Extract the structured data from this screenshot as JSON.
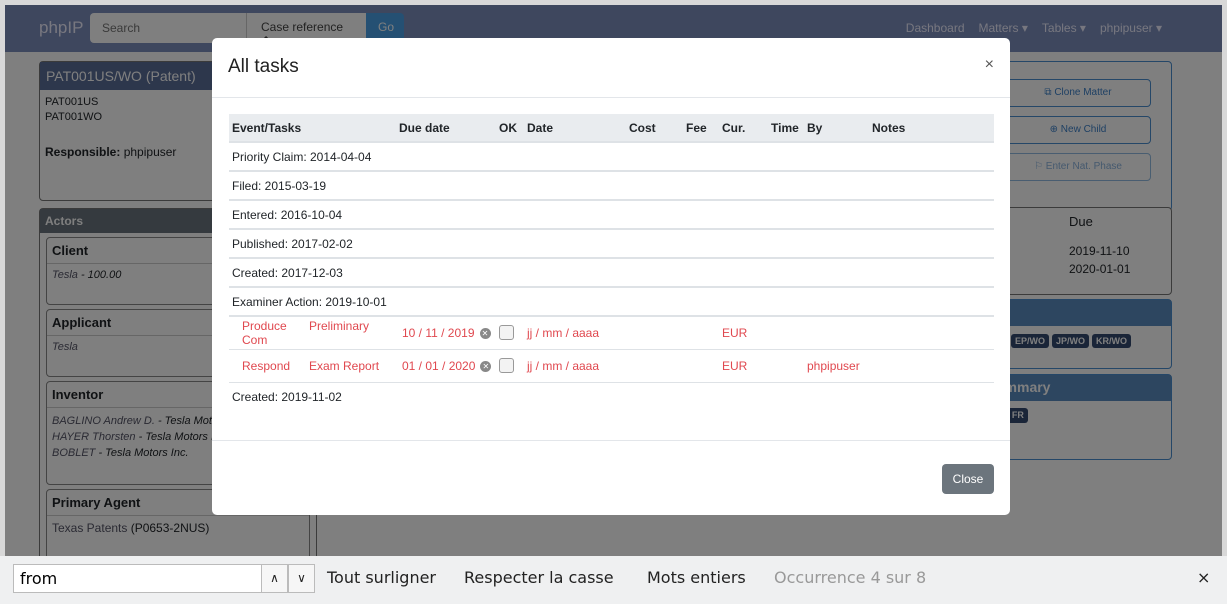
{
  "navbar": {
    "brand": "phpIP",
    "search_placeholder": "Search",
    "search_select": "Case reference",
    "go": "Go",
    "items": [
      "Dashboard",
      "Matters ▾",
      "Tables ▾",
      "phpipuser ▾"
    ]
  },
  "matter": {
    "title": "PAT001US/WO (Patent)",
    "refs": [
      "PAT001US",
      "PAT001WO"
    ],
    "responsible_label": "Responsible:",
    "responsible": "phpipuser"
  },
  "actions": [
    "⧉ Clone Matter",
    "⊕ New Child",
    "⚐ Enter Nat. Phase"
  ],
  "actors": {
    "title": "Actors",
    "groups": [
      {
        "role": "Client",
        "lines": [
          {
            "name": "Tesla",
            "extra": " - 100.00"
          }
        ]
      },
      {
        "role": "Applicant",
        "lines": [
          {
            "name": "Tesla",
            "extra": ""
          }
        ]
      },
      {
        "role": "Inventor",
        "lines": [
          {
            "name": "BAGLINO Andrew D.",
            "extra": " - Tesla Motors Inc."
          },
          {
            "name": "HAYER Thorsten",
            "extra": " - Tesla Motors Inc."
          },
          {
            "name": "BOBLET",
            "extra": " - Tesla Motors Inc."
          }
        ]
      },
      {
        "role": "Primary Agent",
        "lines": [
          {
            "name": "Texas Patents",
            "extra": " (P0653-2NUS)"
          }
        ]
      }
    ]
  },
  "due": {
    "header": "Due",
    "dates": [
      "2019-11-10",
      "2020-01-01"
    ]
  },
  "family": {
    "tags": [
      "EP/WO",
      "JP/WO",
      "KR/WO"
    ]
  },
  "summary": {
    "title": "ummary",
    "tag": "⧉ FR"
  },
  "modal": {
    "title": "All tasks",
    "close_x": "×",
    "close_button": "Close",
    "columns": [
      "Event/Tasks",
      "Due date",
      "OK",
      "Date",
      "Cost",
      "Fee",
      "Cur.",
      "Time",
      "By",
      "Notes"
    ],
    "rows": [
      {
        "event": "Priority Claim: 2014-04-04"
      },
      {
        "event": "Filed: 2015-03-19"
      },
      {
        "event": "Entered: 2016-10-04"
      },
      {
        "event": "Published: 2017-02-02"
      },
      {
        "event": "Created: 2017-12-03"
      },
      {
        "event": "Examiner Action: 2019-10-01"
      },
      {
        "task": "Produce",
        "detail": "Preliminary Com",
        "due": "10 / 11 / 2019",
        "date": "jj / mm / aaaa",
        "cur": "EUR",
        "by": ""
      },
      {
        "task": "Respond",
        "detail": "Exam Report",
        "due": "01 / 01 / 2020",
        "date": "jj / mm / aaaa",
        "cur": "EUR",
        "by": "phpipuser"
      },
      {
        "event": "Created: 2019-11-02"
      }
    ]
  },
  "findbar": {
    "query": "from",
    "highlight_all": "Tout surligner",
    "match_case": "Respecter la casse",
    "whole_words": "Mots entiers",
    "status": "Occurrence 4 sur 8",
    "close": "×"
  }
}
